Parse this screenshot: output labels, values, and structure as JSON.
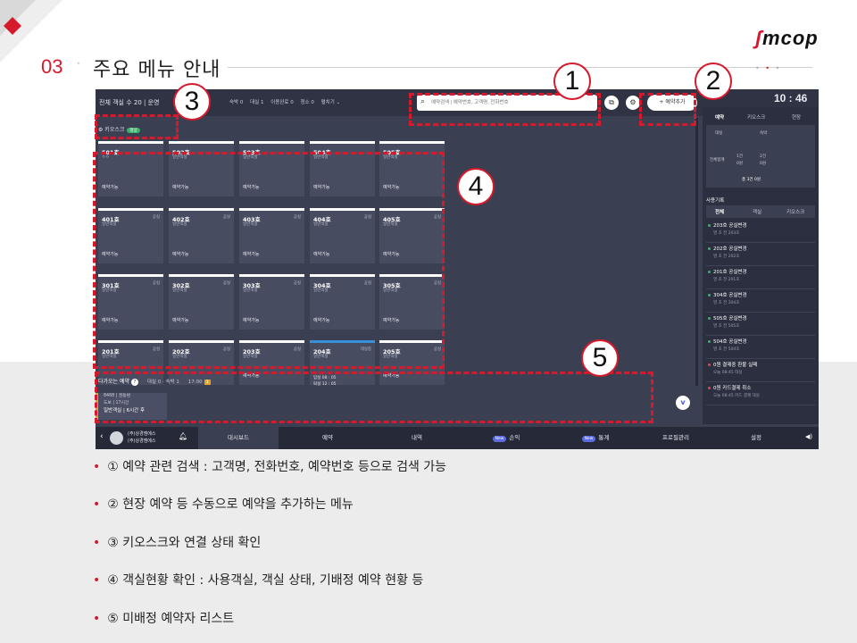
{
  "header": {
    "section_number": "03",
    "title": "주요 메뉴 안내",
    "logo": "mcop"
  },
  "screenshot": {
    "topbar": {
      "total_rooms": "전체 객실 수 20",
      "operation_label": "운영",
      "stats": [
        "숙박 0",
        "대실 1",
        "이용완료 0",
        "청소 0"
      ],
      "more_label": "펼치기 ⌄",
      "search_placeholder": "예약검색 | 예약번호, 고객명, 전화번호",
      "add_button": "+ 예약추가",
      "clock": "10 : 46"
    },
    "kiosk": {
      "label": "키오스크",
      "status": "정상"
    },
    "rooms": [
      [
        {
          "no": "501호",
          "status": "",
          "type": "ㅇㅇ",
          "state": "예약가능"
        },
        {
          "no": "502호",
          "status": "",
          "type": "일반객실",
          "state": "예약가능"
        },
        {
          "no": "503호",
          "status": "",
          "type": "일반객실",
          "state": "예약가능"
        },
        {
          "no": "504호",
          "status": "",
          "type": "일반객실",
          "state": "예약가능"
        },
        {
          "no": "505호",
          "status": "",
          "type": "일반객실",
          "state": "예약가능"
        }
      ],
      [
        {
          "no": "401호",
          "status": "공실",
          "type": "일반객실",
          "state": "예약가능"
        },
        {
          "no": "402호",
          "status": "공실",
          "type": "일반객실",
          "state": "예약가능"
        },
        {
          "no": "403호",
          "status": "공실",
          "type": "일반객실",
          "state": "예약가능"
        },
        {
          "no": "404호",
          "status": "공실",
          "type": "일반객실",
          "state": "예약가능"
        },
        {
          "no": "405호",
          "status": "공실",
          "type": "일반객실",
          "state": "예약가능"
        }
      ],
      [
        {
          "no": "301호",
          "status": "공실",
          "type": "일반객실",
          "state": "예약가능"
        },
        {
          "no": "302호",
          "status": "공실",
          "type": "일반객실",
          "state": "예약가능"
        },
        {
          "no": "303호",
          "status": "공실",
          "type": "일반객실",
          "state": "예약가능"
        },
        {
          "no": "304호",
          "status": "공실",
          "type": "일반객실",
          "state": "예약가능"
        },
        {
          "no": "305호",
          "status": "공실",
          "type": "일반객실",
          "state": "예약가능"
        }
      ],
      [
        {
          "no": "201호",
          "status": "공실",
          "type": "일반객실",
          "state": ""
        },
        {
          "no": "202호",
          "status": "공실",
          "type": "일반객실",
          "state": ""
        },
        {
          "no": "203호",
          "status": "공실",
          "type": "일반객실",
          "state": "예약가능"
        },
        {
          "no": "204호",
          "status": "대실중",
          "type": "일반객실",
          "state": ""
        },
        {
          "no": "205호",
          "status": "공실",
          "type": "일반객실",
          "state": "예약가능"
        }
      ]
    ],
    "room_204_detail": [
      "입실 08 : 05",
      "퇴실 12 : 05"
    ],
    "arrival": {
      "label": "다가오는 예약",
      "counts": "대실 0 · 숙박 1",
      "time": "17:00",
      "badge": "1"
    },
    "pending": [
      "8468 | 권동환",
      "도보 | 17시간",
      "일반객실 | 6시간 후"
    ],
    "side": {
      "tabs": [
        "예약",
        "키오스크",
        "현장"
      ],
      "summary_rows": [
        "대실",
        "숙박"
      ],
      "summary_total_label": "전체합계",
      "summary_values": [
        "1건",
        "2건",
        "0원",
        "0원"
      ],
      "summary_total": "총 3건 0원",
      "history_title": "사용기록",
      "history_tabs": [
        "전체",
        "객실",
        "키오스크"
      ],
      "history": [
        {
          "title": "203호 공실변경",
          "sub": "영 초 전   203호"
        },
        {
          "title": "202호 공실변경",
          "sub": "영 초 전   202호"
        },
        {
          "title": "201호 공실변경",
          "sub": "영 초 전   201호"
        },
        {
          "title": "304호 공실변경",
          "sub": "영 초 전   304호"
        },
        {
          "title": "505호 공실변경",
          "sub": "영 초 전   505호"
        },
        {
          "title": "504호 공실변경",
          "sub": "영 초 전   504호"
        },
        {
          "title": "0원 결제중 환불 실패",
          "sub": "오늘 08:45   대실"
        },
        {
          "title": "0원 카드결제 취소",
          "sub": "오늘 08:45   카드 결제   대실"
        }
      ]
    },
    "bottombar": {
      "company_line1": "(주)상경엠에스",
      "company_line2": "(주)상경엠에스",
      "nav": [
        "대시보드",
        "예약",
        "내역",
        "손익",
        "통계",
        "프로필관리",
        "설정"
      ],
      "new_badge": "New"
    }
  },
  "callouts": [
    "1",
    "2",
    "3",
    "4",
    "5"
  ],
  "bullets": [
    "① 예약 관련 검색 : 고객명, 전화번호, 예약번호 등으로 검색 가능",
    "② 현장 예약 등 수동으로 예약을 추가하는 메뉴",
    "③ 키오스크와 연결 상태 확인",
    "④ 객실현황 확인 : 사용객실, 객실 상태, 기배정 예약 현황 등",
    "⑤ 미배정 예약자 리스트"
  ],
  "colors": {
    "accent": "#d7192c",
    "panel": "#3a3f52",
    "dark": "#262a38"
  }
}
